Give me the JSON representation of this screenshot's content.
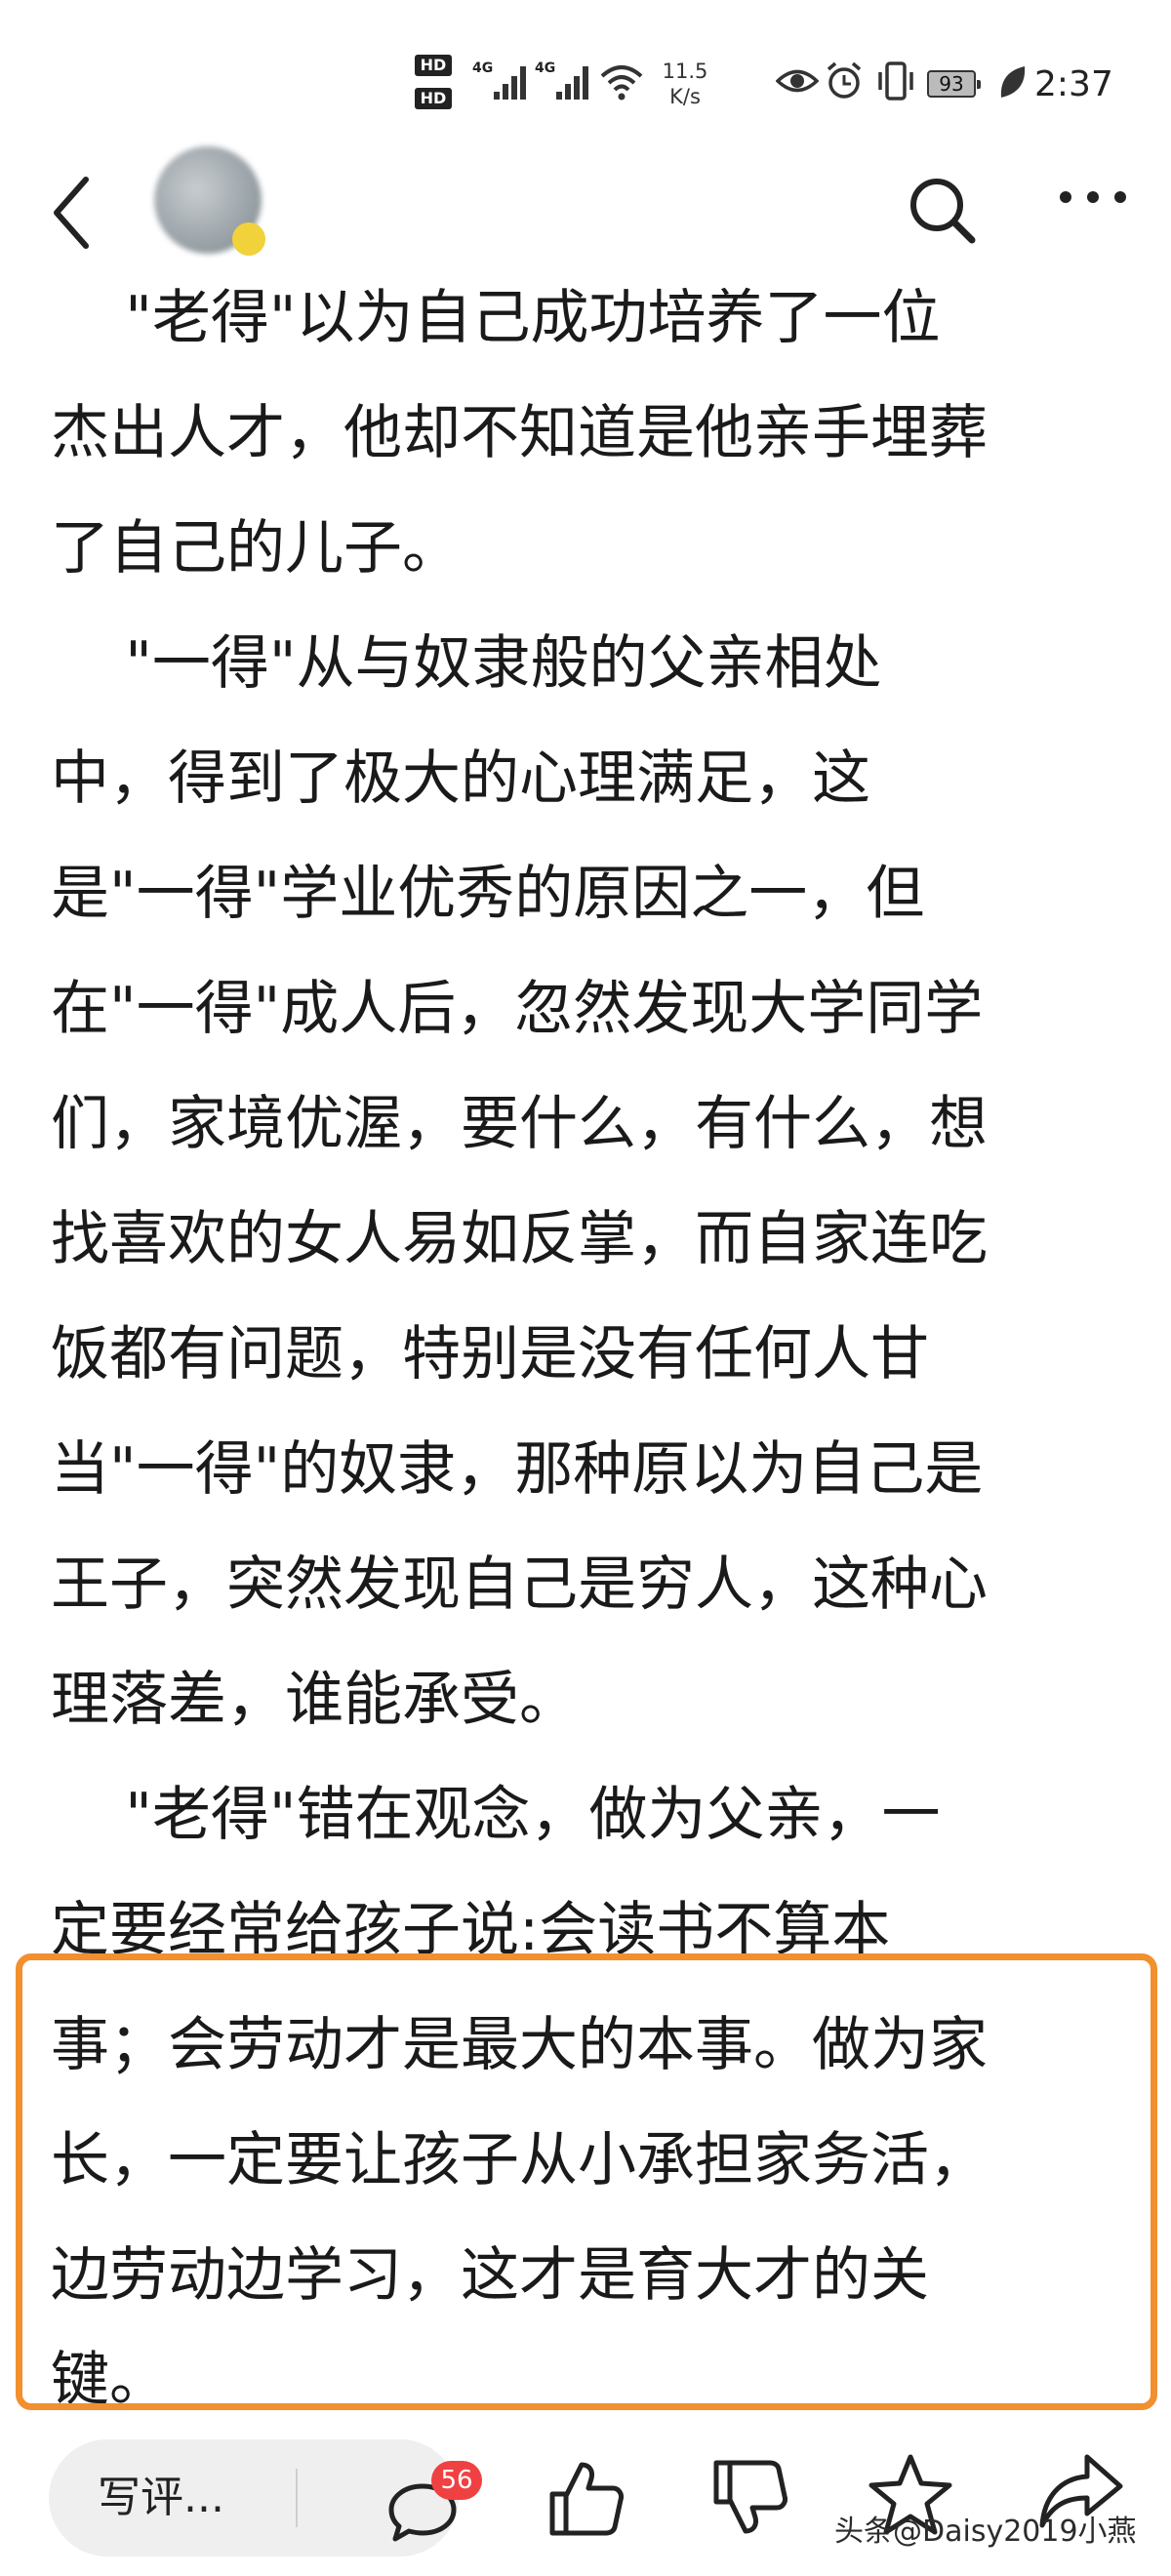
{
  "status_bar": {
    "hd1": "HD",
    "hd2": "HD",
    "signal1_gen": "4G",
    "signal2_gen": "4G",
    "net_speed_value": "11.5",
    "net_speed_unit": "K/s",
    "battery_level": "93",
    "time": "2:37"
  },
  "nav": {
    "author_name": "",
    "author_subtitle": ""
  },
  "article": {
    "lines": [
      "    \"老得\"以为自己成功培养了一位",
      "杰出人才，他却不知道是他亲手埋葬",
      "了自己的儿子。",
      "    \"一得\"从与奴隶般的父亲相处",
      "中，得到了极大的心理满足，这",
      "是\"一得\"学业优秀的原因之一，但",
      "在\"一得\"成人后，忽然发现大学同学",
      "们，家境优渥，要什么，有什么，想",
      "找喜欢的女人易如反掌，而自家连吃",
      "饭都有问题，特别是没有任何人甘",
      "当\"一得\"的奴隶，那种原以为自己是",
      "王子，突然发现自己是穷人，这种心",
      "理落差，谁能承受。",
      "    \"老得\"错在观念，做为父亲，一",
      "定要经常给孩子说:会读书不算本",
      "事；会劳动才是最大的本事。做为家",
      "长，一定要让孩子从小承担家务活，",
      "边劳动边学习，这才是育大才的关",
      "键。"
    ],
    "highlight_color": "#f28f2e"
  },
  "bottom_bar": {
    "comment_placeholder": "写评...",
    "comment_count": "56",
    "badge_color": "#f04142",
    "icons": [
      "comment-icon",
      "thumbs-up-icon",
      "thumbs-down-icon",
      "star-icon",
      "share-icon"
    ],
    "watermark": "头条@Daisy2019小燕"
  }
}
